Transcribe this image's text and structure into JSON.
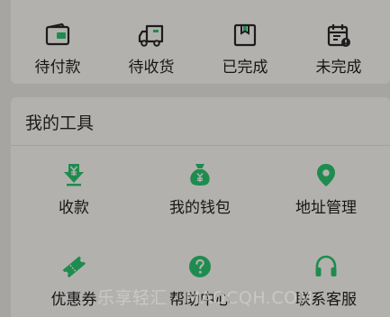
{
  "orders": {
    "items": [
      {
        "label": "待付款",
        "icon": "wallet-icon"
      },
      {
        "label": "待收货",
        "icon": "truck-icon"
      },
      {
        "label": "已完成",
        "icon": "box-icon"
      },
      {
        "label": "未完成",
        "icon": "calendar-alert-icon"
      }
    ]
  },
  "tools": {
    "title": "我的工具",
    "items": [
      {
        "label": "收款",
        "icon": "yuan-download-icon"
      },
      {
        "label": "我的钱包",
        "icon": "money-bag-icon"
      },
      {
        "label": "地址管理",
        "icon": "location-pin-icon"
      },
      {
        "label": "优惠券",
        "icon": "coupon-icon"
      },
      {
        "label": "帮助中心",
        "icon": "help-icon"
      },
      {
        "label": "联系客服",
        "icon": "headset-icon"
      }
    ]
  },
  "watermark": "乐享轻汇 · MAOCQH.COM",
  "colors": {
    "accent": "#1e8c4f",
    "background": "#a7a5a2",
    "card": "#b3b1ae"
  }
}
